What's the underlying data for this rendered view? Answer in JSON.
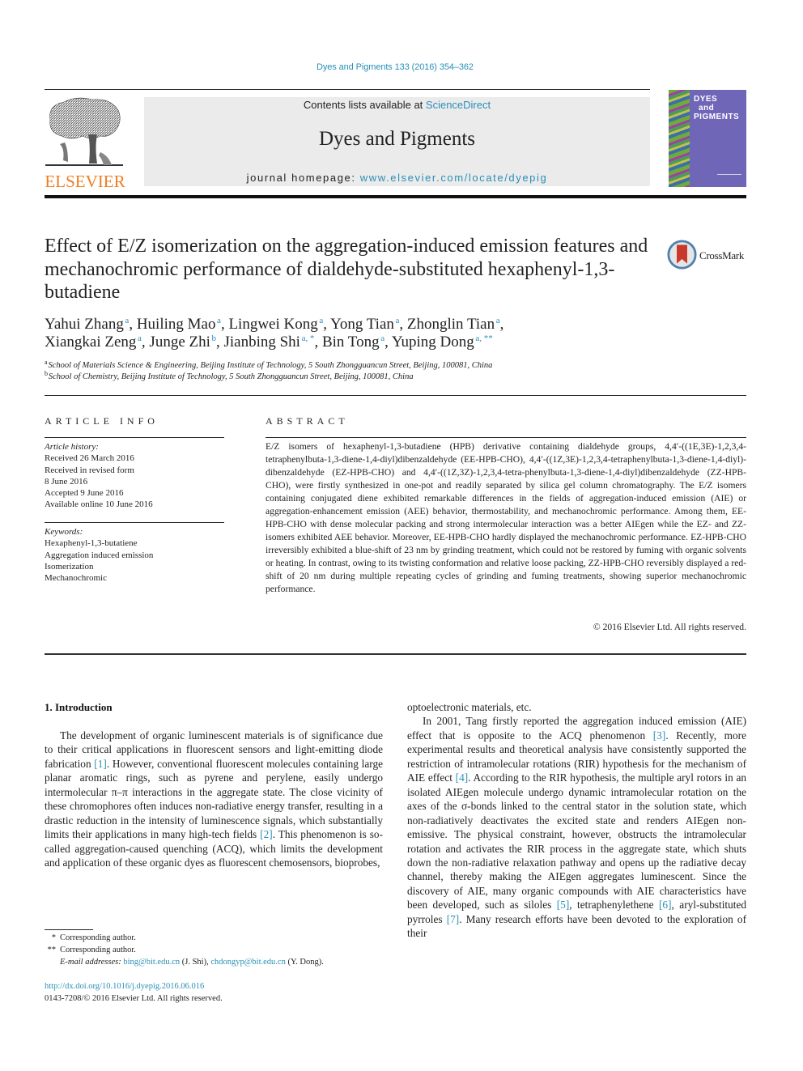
{
  "header": {
    "citation": "Dyes and Pigments 133 (2016) 354–362",
    "publisher_logo_text": "ELSEVIER",
    "contents_prefix": "Contents lists available at ",
    "contents_link": "ScienceDirect",
    "journal_title": "Dyes and Pigments",
    "homepage_prefix": "journal homepage: ",
    "homepage_link": "www.elsevier.com/locate/dyepig",
    "cover": {
      "line1": "DYES",
      "line2": "and",
      "line3": "PIGMENTS"
    },
    "colors": {
      "link": "#2a8fb8",
      "elsevier_orange": "#f07d1e",
      "cover_purple": "#6f66b8",
      "masthead_gray": "#ebebeb"
    }
  },
  "article": {
    "title": "Effect of E/Z isomerization on the aggregation-induced emission features and mechanochromic performance of dialdehyde-substituted hexaphenyl-1,3-butadiene",
    "crossmark_label": "CrossMark",
    "authors": [
      {
        "name": "Yahui Zhang",
        "sup": "a"
      },
      {
        "name": "Huiling Mao",
        "sup": "a"
      },
      {
        "name": "Lingwei Kong",
        "sup": "a"
      },
      {
        "name": "Yong Tian",
        "sup": "a"
      },
      {
        "name": "Zhonglin Tian",
        "sup": "a"
      },
      {
        "name": "Xiangkai Zeng",
        "sup": "a"
      },
      {
        "name": "Junge Zhi",
        "sup": "b"
      },
      {
        "name": "Jianbing Shi",
        "sup": "a, *"
      },
      {
        "name": "Bin Tong",
        "sup": "a"
      },
      {
        "name": "Yuping Dong",
        "sup": "a, **"
      }
    ],
    "affiliations": [
      {
        "mark": "a",
        "text": "School of Materials Science & Engineering, Beijing Institute of Technology, 5 South Zhongguancun Street, Beijing, 100081, China"
      },
      {
        "mark": "b",
        "text": "School of Chemistry, Beijing Institute of Technology, 5 South Zhongguancun Street, Beijing, 100081, China"
      }
    ]
  },
  "article_info": {
    "heading": "ARTICLE INFO",
    "history_label": "Article history:",
    "history": [
      "Received 26 March 2016",
      "Received in revised form",
      "8 June 2016",
      "Accepted 9 June 2016",
      "Available online 10 June 2016"
    ],
    "keywords_label": "Keywords:",
    "keywords": [
      "Hexaphenyl-1,3-butatiene",
      "Aggregation induced emission",
      "Isomerization",
      "Mechanochromic"
    ]
  },
  "abstract": {
    "heading": "ABSTRACT",
    "text": "E/Z isomers of hexaphenyl-1,3-butadiene (HPB) derivative containing dialdehyde groups, 4,4′-((1E,3E)-1,2,3,4-tetraphenylbuta-1,3-diene-1,4-diyl)dibenzaldehyde (EE-HPB-CHO), 4,4′-((1Z,3E)-1,2,3,4-tetraphenylbuta-1,3-diene-1,4-diyl)-dibenzaldehyde (EZ-HPB-CHO) and 4,4′-((1Z,3Z)-1,2,3,4-tetra-phenylbuta-1,3-diene-1,4-diyl)dibenzaldehyde (ZZ-HPB-CHO), were firstly synthesized in one-pot and readily separated by silica gel column chromatography. The E/Z isomers containing conjugated diene exhibited remarkable differences in the fields of aggregation-induced emission (AIE) or aggregation-enhancement emission (AEE) behavior, thermostability, and mechanochromic performance. Among them, EE-HPB-CHO with dense molecular packing and strong intermolecular interaction was a better AIEgen while the EZ- and ZZ-isomers exhibited AEE behavior. Moreover, EE-HPB-CHO hardly displayed the mechanochromic performance. EZ-HPB-CHO irreversibly exhibited a blue-shift of 23 nm by grinding treatment, which could not be restored by fuming with organic solvents or heating. In contrast, owing to its twisting conformation and relative loose packing, ZZ-HPB-CHO reversibly displayed a red-shift of 20 nm during multiple repeating cycles of grinding and fuming treatments, showing superior mechanochromic performance.",
    "copyright": "© 2016 Elsevier Ltd. All rights reserved."
  },
  "introduction": {
    "heading": "1.  Introduction",
    "left_paragraph": [
      {
        "t": "The development of organic luminescent materials is of significance due to their critical applications in fluorescent sensors and light-emitting diode fabrication "
      },
      {
        "ref": "[1]"
      },
      {
        "t": ". However, conventional fluorescent molecules containing large planar aromatic rings, such as pyrene and perylene, easily undergo intermolecular π–π interactions in the aggregate state. The close vicinity of these chromophores often induces non-radiative energy transfer, resulting in a drastic reduction in the intensity of luminescence signals, which substantially limits their applications in many high-tech fields "
      },
      {
        "ref": "[2]"
      },
      {
        "t": ". This phenomenon is so-called aggregation-caused quenching (ACQ), which limits the development and application of these organic dyes as fluorescent chemosensors, bioprobes,"
      }
    ],
    "right_continuation": "optoelectronic materials, etc.",
    "right_paragraph": [
      {
        "t": "In 2001, Tang firstly reported the aggregation induced emission (AIE) effect that is opposite to the ACQ phenomenon "
      },
      {
        "ref": "[3]"
      },
      {
        "t": ". Recently, more experimental results and theoretical analysis have consistently supported the restriction of intramolecular rotations (RIR) hypothesis for the mechanism of AIE effect "
      },
      {
        "ref": "[4]"
      },
      {
        "t": ". According to the RIR hypothesis, the multiple aryl rotors in an isolated AIEgen molecule undergo dynamic intramolecular rotation on the axes of the σ-bonds linked to the central stator in the solution state, which non-radiatively deactivates the excited state and renders AIEgen non-emissive. The physical constraint, however, obstructs the intramolecular rotation and activates the RIR process in the aggregate state, which shuts down the non-radiative relaxation pathway and opens up the radiative decay channel, thereby making the AIEgen aggregates luminescent. Since the discovery of AIE, many organic compounds with AIE characteristics have been developed, such as siloles "
      },
      {
        "ref": "[5]"
      },
      {
        "t": ", tetraphenylethene "
      },
      {
        "ref": "[6]"
      },
      {
        "t": ", aryl-substituted pyrroles "
      },
      {
        "ref": "[7]"
      },
      {
        "t": ". Many research efforts have been devoted to the exploration of their"
      }
    ]
  },
  "footnotes": {
    "corr1_mark": "*",
    "corr1_text": "Corresponding author.",
    "corr2_mark": "**",
    "corr2_text": "Corresponding author.",
    "email_label": "E-mail addresses:",
    "email1": "bing@bit.edu.cn",
    "email1_owner": " (J. Shi), ",
    "email2": "chdongyp@bit.edu.cn",
    "email2_owner": " (Y. Dong).",
    "doi": "http://dx.doi.org/10.1016/j.dyepig.2016.06.016",
    "issn_copyright": "0143-7208/© 2016 Elsevier Ltd. All rights reserved."
  }
}
